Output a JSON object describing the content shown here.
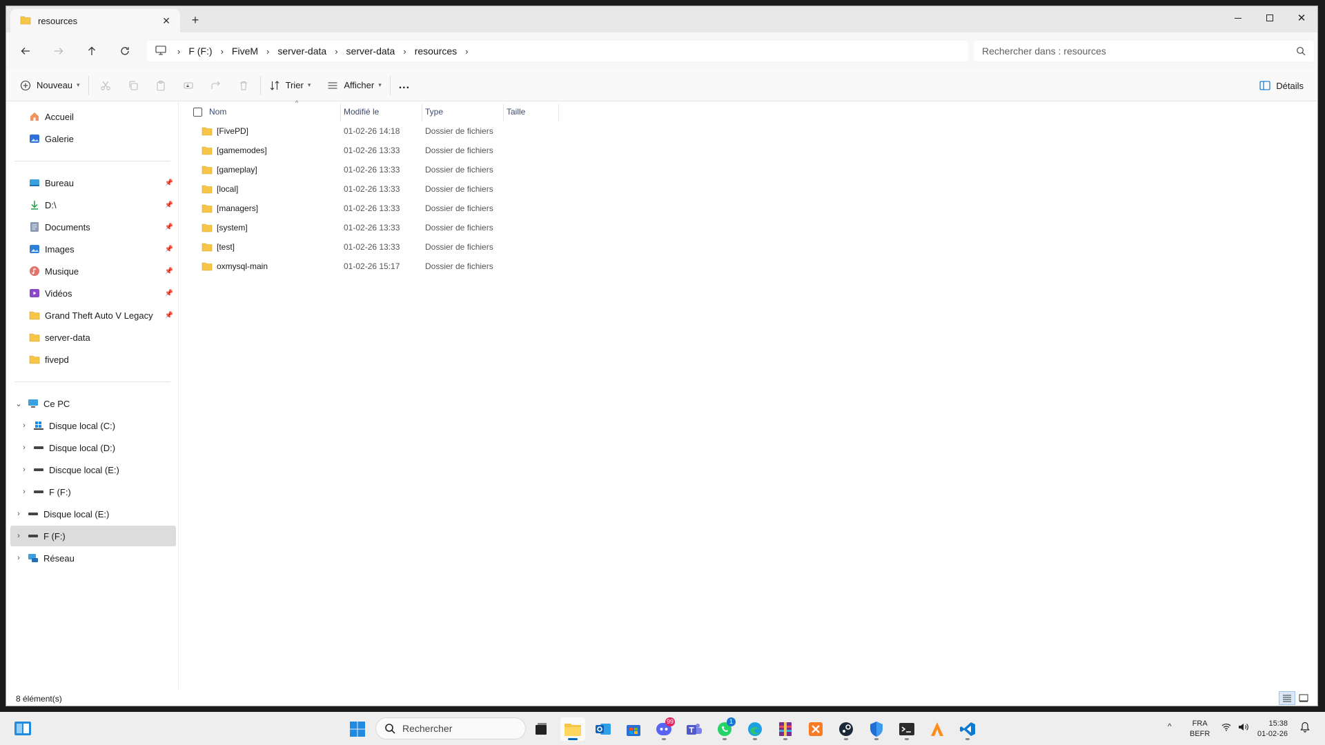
{
  "tab": {
    "title": "resources"
  },
  "breadcrumb": [
    "F (F:)",
    "FiveM",
    "server-data",
    "server-data",
    "resources"
  ],
  "search": {
    "placeholder": "Rechercher dans : resources"
  },
  "toolbar": {
    "new_label": "Nouveau",
    "sort_label": "Trier",
    "view_label": "Afficher",
    "details_label": "Détails",
    "more_label": "..."
  },
  "sidebar": {
    "home": "Accueil",
    "gallery": "Galerie",
    "quick": [
      "Bureau",
      "D:\\",
      "Documents",
      "Images",
      "Musique",
      "Vidéos",
      "Grand Theft Auto V Legacy",
      "server-data",
      "fivepd"
    ],
    "this_pc": "Ce PC",
    "drives": [
      "Disque local (C:)",
      "Disque local (D:)",
      "Discque local (E:)",
      "F (F:)"
    ],
    "extra": [
      "Disque local (E:)",
      "F (F:)",
      "Réseau"
    ]
  },
  "columns": {
    "name": "Nom",
    "modified": "Modifié le",
    "type": "Type",
    "size": "Taille"
  },
  "files": [
    {
      "name": "[FivePD]",
      "modified": "01-02-26 14:18",
      "type": "Dossier de fichiers"
    },
    {
      "name": "[gamemodes]",
      "modified": "01-02-26 13:33",
      "type": "Dossier de fichiers"
    },
    {
      "name": "[gameplay]",
      "modified": "01-02-26 13:33",
      "type": "Dossier de fichiers"
    },
    {
      "name": "[local]",
      "modified": "01-02-26 13:33",
      "type": "Dossier de fichiers"
    },
    {
      "name": "[managers]",
      "modified": "01-02-26 13:33",
      "type": "Dossier de fichiers"
    },
    {
      "name": "[system]",
      "modified": "01-02-26 13:33",
      "type": "Dossier de fichiers"
    },
    {
      "name": "[test]",
      "modified": "01-02-26 13:33",
      "type": "Dossier de fichiers"
    },
    {
      "name": "oxmysql-main",
      "modified": "01-02-26 15:17",
      "type": "Dossier de fichiers"
    }
  ],
  "status": {
    "count": "8 élément(s)"
  },
  "taskbar": {
    "search_placeholder": "Rechercher",
    "discord_badge": "99",
    "whatsapp_badge": "1",
    "lang_top": "FRA",
    "lang_bottom": "BEFR",
    "time": "15:38",
    "date": "01-02-26"
  },
  "colors": {
    "accent": "#0067c0",
    "folder": "#f7c548",
    "selection": "#dcdcdc"
  }
}
